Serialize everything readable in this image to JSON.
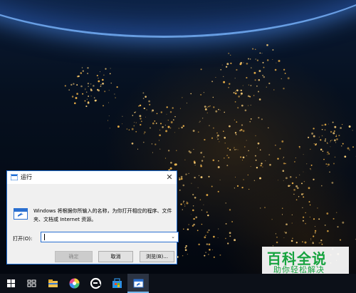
{
  "dialog": {
    "title": "运行",
    "close_glyph": "✕",
    "description": "Windows 将根据你所输入的名称，为你打开相应的程序、文件夹、文档或 Internet 资源。",
    "open_label": "打开(O):",
    "open_value": "",
    "ok_label": "确定",
    "cancel_label": "取消",
    "browse_label": "浏览(B)...",
    "dropdown_glyph": "⌄"
  },
  "watermark": {
    "title": "百科全说",
    "subtitle": "助你轻松解决"
  },
  "taskbar": {
    "icons": [
      "windows-start-icon",
      "task-view-icon",
      "file-explorer-icon",
      "browser-icon",
      "edge-icon",
      "store-icon",
      "run-icon"
    ]
  },
  "colors": {
    "accent": "#1f6fd6",
    "watermark_green": "#16a33e",
    "taskbar": "#0c1018"
  }
}
